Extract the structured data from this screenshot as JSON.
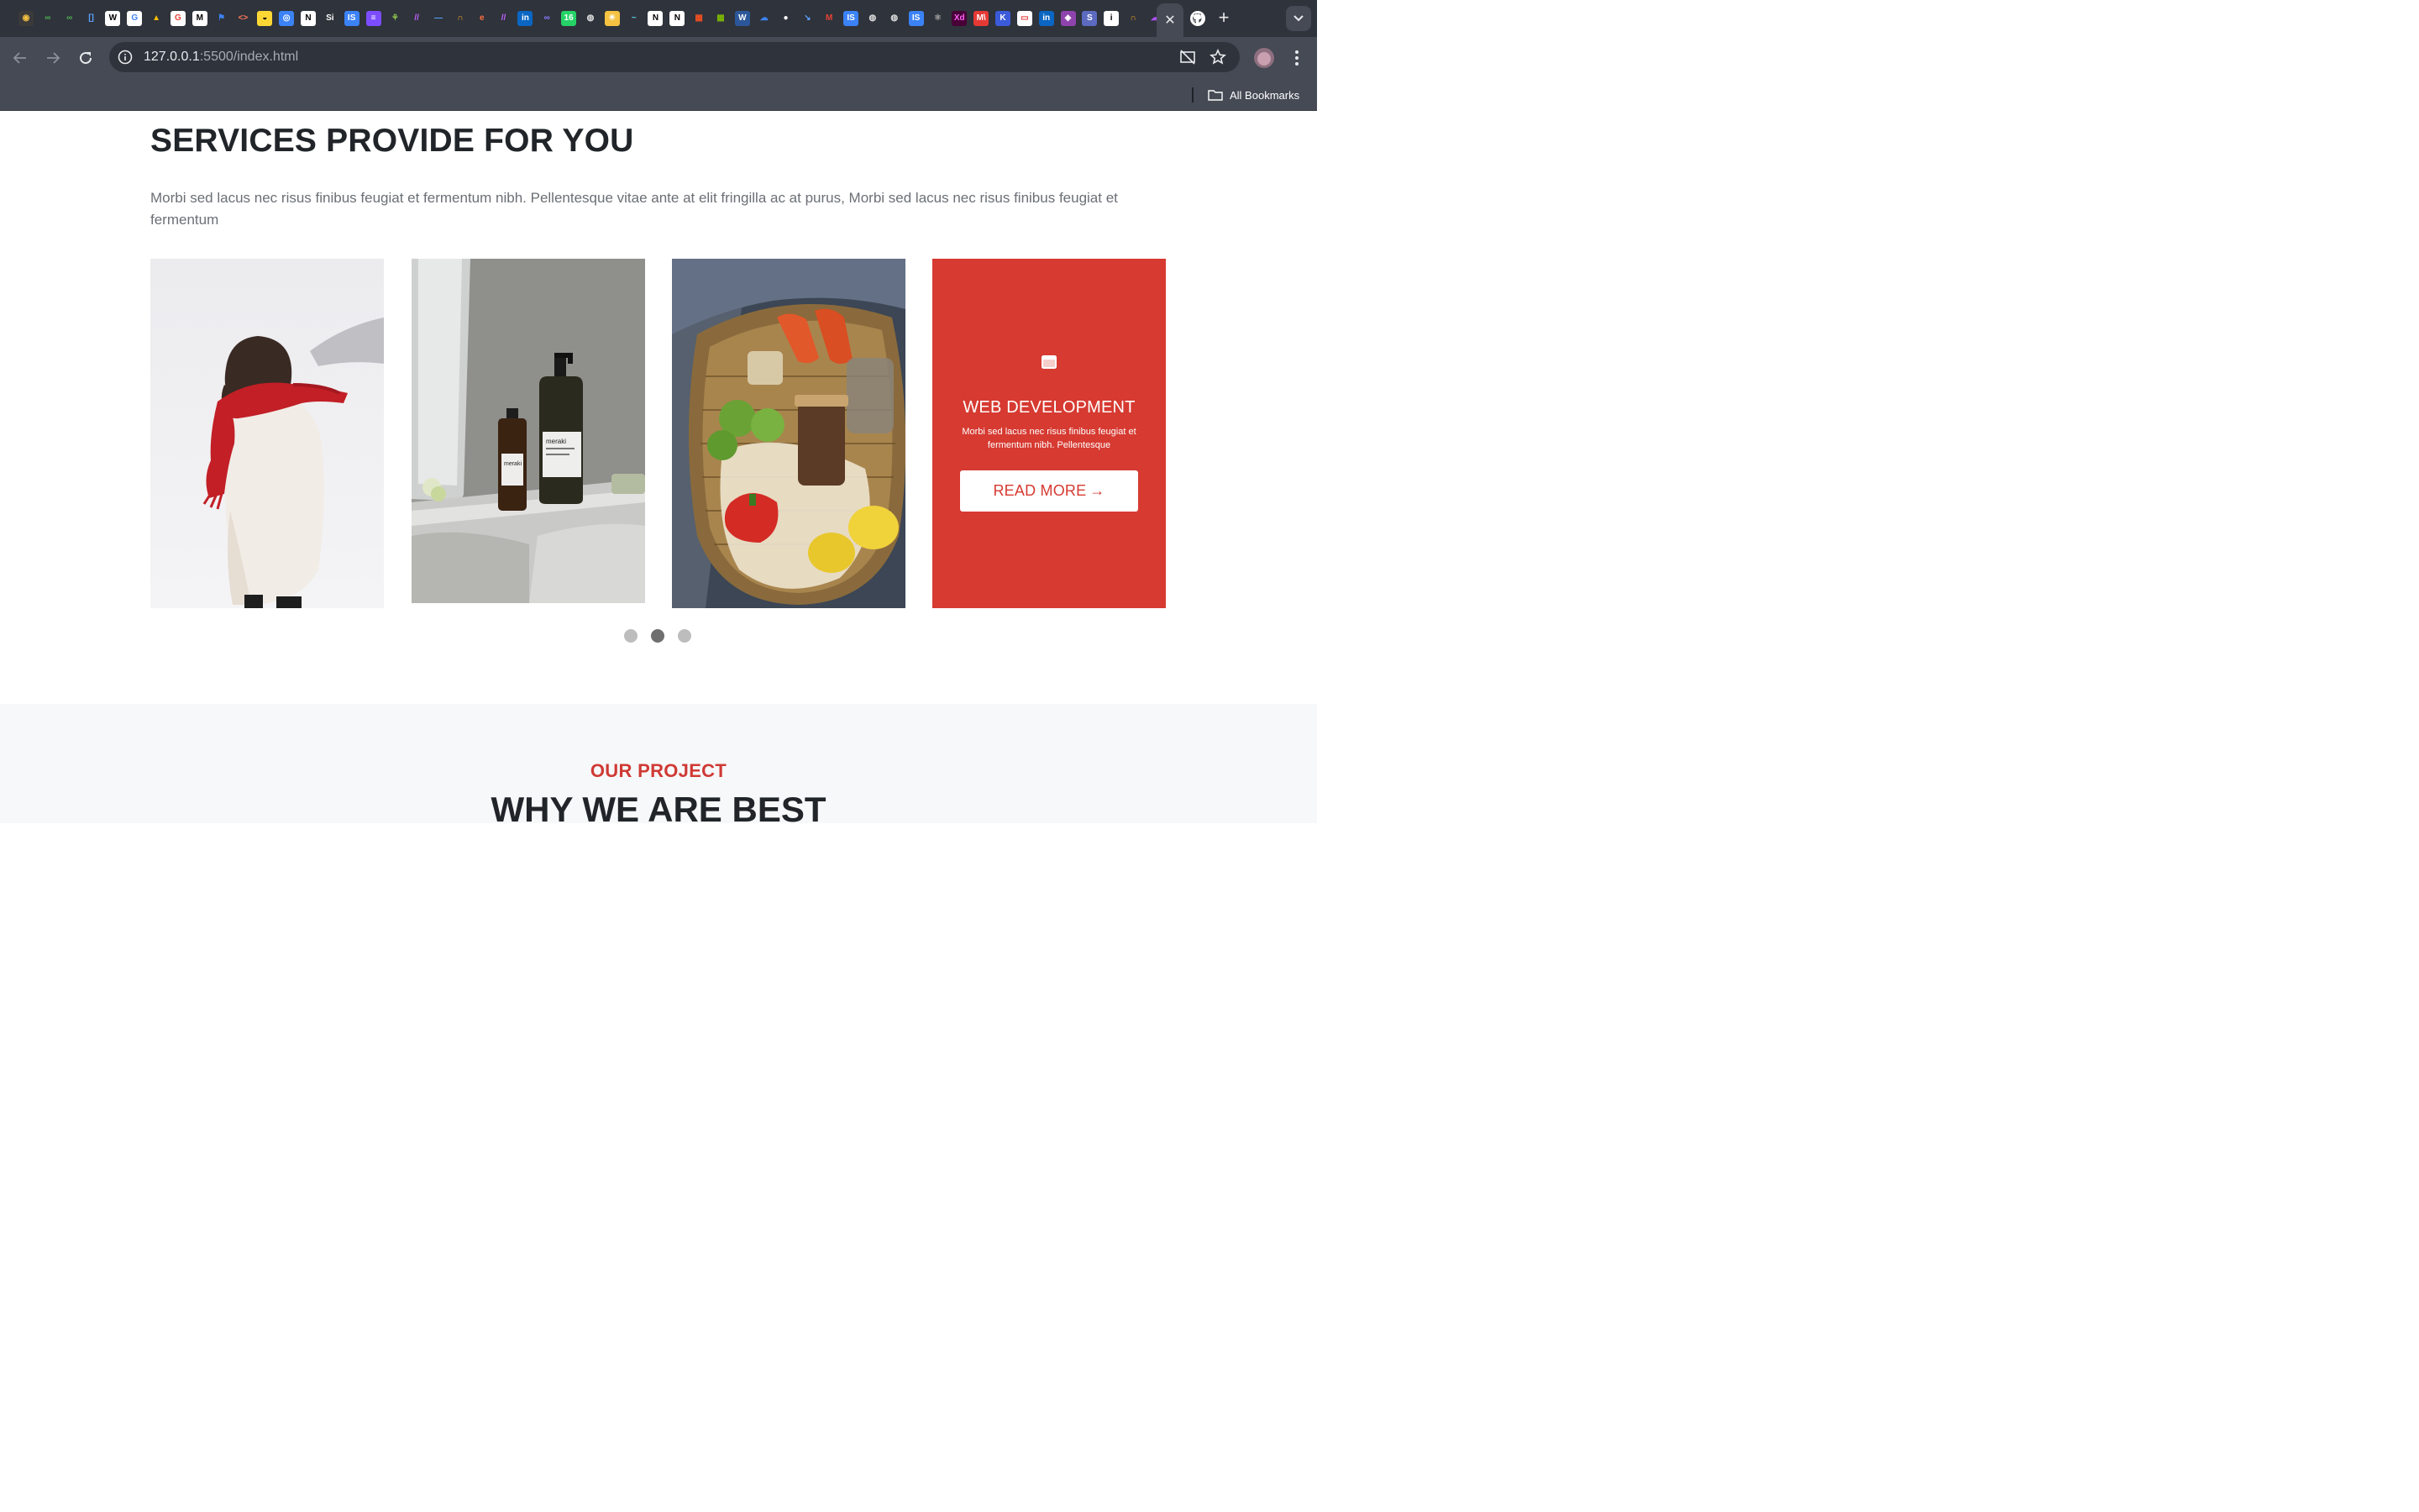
{
  "browser": {
    "url_host": "127.0.0.1",
    "url_path": ":5500/index.html",
    "bookmarks_label": "All Bookmarks",
    "active_tab_close": "✕",
    "new_tab": "+",
    "favicons": [
      {
        "name": "chatgpt-icon",
        "glyph": "◉",
        "bg": "#3a3a3a",
        "fg": "#f5c242"
      },
      {
        "name": "link-icon-1",
        "glyph": "∞",
        "bg": "transparent",
        "fg": "#4caf50"
      },
      {
        "name": "link-icon-2",
        "glyph": "∞",
        "bg": "transparent",
        "fg": "#4caf50"
      },
      {
        "name": "bracket-icon",
        "glyph": "[]",
        "bg": "transparent",
        "fg": "#5aa0ff"
      },
      {
        "name": "wix-icon",
        "glyph": "W",
        "bg": "#ffffff",
        "fg": "#000000"
      },
      {
        "name": "google-icon",
        "glyph": "G",
        "bg": "#ffffff",
        "fg": "#4285f4"
      },
      {
        "name": "drive-icon",
        "glyph": "▲",
        "bg": "transparent",
        "fg": "#fbbc04"
      },
      {
        "name": "google-icon-2",
        "glyph": "G",
        "bg": "#ffffff",
        "fg": "#ea4335"
      },
      {
        "name": "medium-icon",
        "glyph": "M",
        "bg": "#ffffff",
        "fg": "#000000"
      },
      {
        "name": "flag-icon",
        "glyph": "⚑",
        "bg": "transparent",
        "fg": "#3b82f6"
      },
      {
        "name": "code-icon",
        "glyph": "<>",
        "bg": "transparent",
        "fg": "#ff7a59"
      },
      {
        "name": "bee-icon",
        "glyph": "◒",
        "bg": "#fdd835",
        "fg": "#000000"
      },
      {
        "name": "globe-blue-icon",
        "glyph": "◎",
        "bg": "#3b82f6",
        "fg": "#ffffff"
      },
      {
        "name": "notion-icon",
        "glyph": "N",
        "bg": "#ffffff",
        "fg": "#000000"
      },
      {
        "name": "si-icon",
        "glyph": "Si",
        "bg": "transparent",
        "fg": "#ffffff"
      },
      {
        "name": "is-icon",
        "glyph": "IS",
        "bg": "#3b82f6",
        "fg": "#ffffff"
      },
      {
        "name": "list-icon",
        "glyph": "≡",
        "bg": "#7c4dff",
        "fg": "#ffffff"
      },
      {
        "name": "leaf-icon",
        "glyph": "⚘",
        "bg": "transparent",
        "fg": "#8bc34a"
      },
      {
        "name": "stripe-icon",
        "glyph": "//",
        "bg": "transparent",
        "fg": "#c061ff"
      },
      {
        "name": "dash-icon",
        "glyph": "—",
        "bg": "transparent",
        "fg": "#5aa0ff"
      },
      {
        "name": "headset-icon",
        "glyph": "∩",
        "bg": "transparent",
        "fg": "#f5a623"
      },
      {
        "name": "edge-icon",
        "glyph": "e",
        "bg": "transparent",
        "fg": "#ff7043"
      },
      {
        "name": "stripe-icon-2",
        "glyph": "//",
        "bg": "transparent",
        "fg": "#c061ff"
      },
      {
        "name": "linkedin-icon",
        "glyph": "in",
        "bg": "#0a66c2",
        "fg": "#ffffff"
      },
      {
        "name": "infinity-icon",
        "glyph": "∞",
        "bg": "transparent",
        "fg": "#8a7dff"
      },
      {
        "name": "whatsapp-icon",
        "glyph": "16",
        "bg": "#25d366",
        "fg": "#ffffff"
      },
      {
        "name": "globe-icon",
        "glyph": "◍",
        "bg": "transparent",
        "fg": "#e0e0e0"
      },
      {
        "name": "sun-icon",
        "glyph": "☀",
        "bg": "#f5c242",
        "fg": "#ffffff"
      },
      {
        "name": "tilde-icon",
        "glyph": "~",
        "bg": "transparent",
        "fg": "#5ad1e6"
      },
      {
        "name": "notion-icon-2",
        "glyph": "N",
        "bg": "#ffffff",
        "fg": "#000000"
      },
      {
        "name": "notion-icon-3",
        "glyph": "N",
        "bg": "#ffffff",
        "fg": "#000000"
      },
      {
        "name": "microsoft-icon",
        "glyph": "▦",
        "bg": "transparent",
        "fg": "#f25022"
      },
      {
        "name": "microsoft-icon-2",
        "glyph": "▦",
        "bg": "transparent",
        "fg": "#7fba00"
      },
      {
        "name": "word-icon",
        "glyph": "W",
        "bg": "#2b579a",
        "fg": "#ffffff"
      },
      {
        "name": "onedrive-icon",
        "glyph": "☁",
        "bg": "transparent",
        "fg": "#3b82f6"
      },
      {
        "name": "github-icon",
        "glyph": "●",
        "bg": "transparent",
        "fg": "#ffffff"
      },
      {
        "name": "arrow-icon",
        "glyph": "↘",
        "bg": "transparent",
        "fg": "#5aa0ff"
      },
      {
        "name": "gmail-icon",
        "glyph": "M",
        "bg": "transparent",
        "fg": "#ea4335"
      },
      {
        "name": "is-icon-2",
        "glyph": "IS",
        "bg": "#3b82f6",
        "fg": "#ffffff"
      },
      {
        "name": "globe-icon-2",
        "glyph": "◍",
        "bg": "transparent",
        "fg": "#e0e0e0"
      },
      {
        "name": "globe-icon-3",
        "glyph": "◍",
        "bg": "transparent",
        "fg": "#e0e0e0"
      },
      {
        "name": "is-icon-3",
        "glyph": "IS",
        "bg": "#3b82f6",
        "fg": "#ffffff"
      },
      {
        "name": "react-icon",
        "glyph": "⚛",
        "bg": "transparent",
        "fg": "#9e9e9e"
      },
      {
        "name": "xd-icon",
        "glyph": "Xd",
        "bg": "#470137",
        "fg": "#ff61f6"
      },
      {
        "name": "mv-icon",
        "glyph": "M\\",
        "bg": "#e53935",
        "fg": "#ffffff"
      },
      {
        "name": "kotlin-icon",
        "glyph": "K",
        "bg": "#3b5bdb",
        "fg": "#ffffff"
      },
      {
        "name": "red-card-icon",
        "glyph": "▭",
        "bg": "#ffffff",
        "fg": "#e53935"
      },
      {
        "name": "linkedin-icon-2",
        "glyph": "in",
        "bg": "#0a66c2",
        "fg": "#ffffff"
      },
      {
        "name": "shield-icon",
        "glyph": "◈",
        "bg": "#8e44ad",
        "fg": "#ffffff"
      },
      {
        "name": "s-icon",
        "glyph": "S",
        "bg": "#5c6bc0",
        "fg": "#ffffff"
      },
      {
        "name": "info-icon",
        "glyph": "i",
        "bg": "#ffffff",
        "fg": "#000000"
      },
      {
        "name": "headset-icon-2",
        "glyph": "∩",
        "bg": "transparent",
        "fg": "#f5a623"
      },
      {
        "name": "cloud-up-icon",
        "glyph": "☁",
        "bg": "transparent",
        "fg": "#b04fff"
      }
    ]
  },
  "services": {
    "title": "SERVICES PROVIDE FOR YOU",
    "description": "Morbi sed lacus nec risus finibus feugiat et fermentum nibh. Pellentesque vitae ante at elit fringilla ac at purus, Morbi sed lacus nec risus finibus feugiat et fermentum",
    "cards": [
      {
        "image_alt": "Woman with red scarf in snow"
      },
      {
        "image_alt": "Meraki bottles on bathroom shelf"
      },
      {
        "image_alt": "Wicker basket with groceries"
      }
    ],
    "featured": {
      "title": "WEB DEVELOPMENT",
      "text": "Morbi sed lacus nec risus finibus feugiat et fermentum nibh. Pellentesque",
      "button_label": "READ MORE",
      "button_arrow": "→",
      "bottle_label_1": "meraki",
      "bottle_label_2": "meraki"
    },
    "pagination": {
      "total": 3,
      "active": 2
    }
  },
  "project": {
    "kicker": "OUR PROJECT",
    "title": "WHY WE ARE BEST"
  },
  "colors": {
    "accent": "#d63a31",
    "heading": "#212529",
    "body_text": "#6b6f75",
    "chrome_dark": "#2f333b",
    "chrome": "#454a55"
  }
}
